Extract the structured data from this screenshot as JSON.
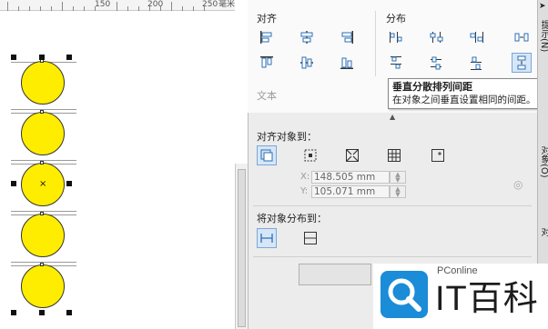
{
  "ruler": {
    "labels": [
      "150",
      "200",
      "250",
      "毫米"
    ]
  },
  "panel": {
    "align_title": "对齐",
    "distribute_title": "分布",
    "text_section": "文本",
    "align_to_title": "对齐对象到：",
    "x_label": "X:",
    "x_value": "148.505 mm",
    "y_label": "Y:",
    "y_value": "105.071 mm",
    "distribute_to_title": "将对象分布到："
  },
  "tooltip": {
    "title": "垂直分散排列间距",
    "description": "在对象之间垂直设置相同的间距。"
  },
  "dock_tabs": [
    "提示(N)",
    "对象(O)",
    "对"
  ],
  "watermark": {
    "site": "PConline",
    "brand": "IT百科"
  },
  "colors": {
    "shape_fill": "#ffed00",
    "panel_bg": "#ececec"
  }
}
